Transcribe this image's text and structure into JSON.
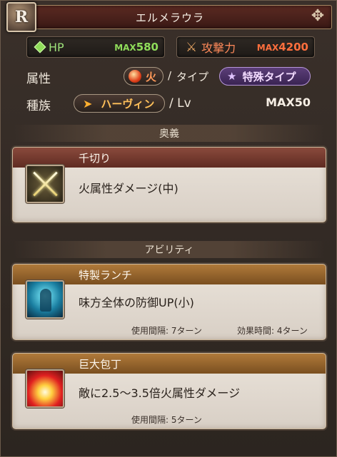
{
  "header": {
    "title": "エルメラウラ",
    "rarity_letter": "R"
  },
  "stats": {
    "hp": {
      "label": "HP",
      "max_prefix": "MAX",
      "value": "580"
    },
    "atk": {
      "label": "攻撃力",
      "max_prefix": "MAX",
      "value": "4200"
    }
  },
  "attribute": {
    "label": "属性",
    "element": "火",
    "slash": "/",
    "type_label": "タイプ",
    "type_value": "特殊タイプ"
  },
  "race": {
    "label": "種族",
    "value": "ハーヴィン",
    "lv_label": "/ Lv",
    "lv_max": "MAX50"
  },
  "ougi": {
    "section_title": "奥義",
    "name": "千切り",
    "description": "火属性ダメージ(中)"
  },
  "abilities_section_title": "アビリティ",
  "abilities": [
    {
      "name": "特製ランチ",
      "description": "味方全体の防御UP(小)",
      "cooldown": "使用間隔: 7ターン",
      "duration": "効果時間: 4ターン"
    },
    {
      "name": "巨大包丁",
      "description": "敵に2.5〜3.5倍火属性ダメージ",
      "cooldown": "使用間隔: 5ターン"
    }
  ],
  "colors": {
    "hp": "#8fdc5a",
    "atk": "#ff6f3d",
    "ougi_header": "#7a3a2e",
    "ability_header": "#9a6a30"
  }
}
